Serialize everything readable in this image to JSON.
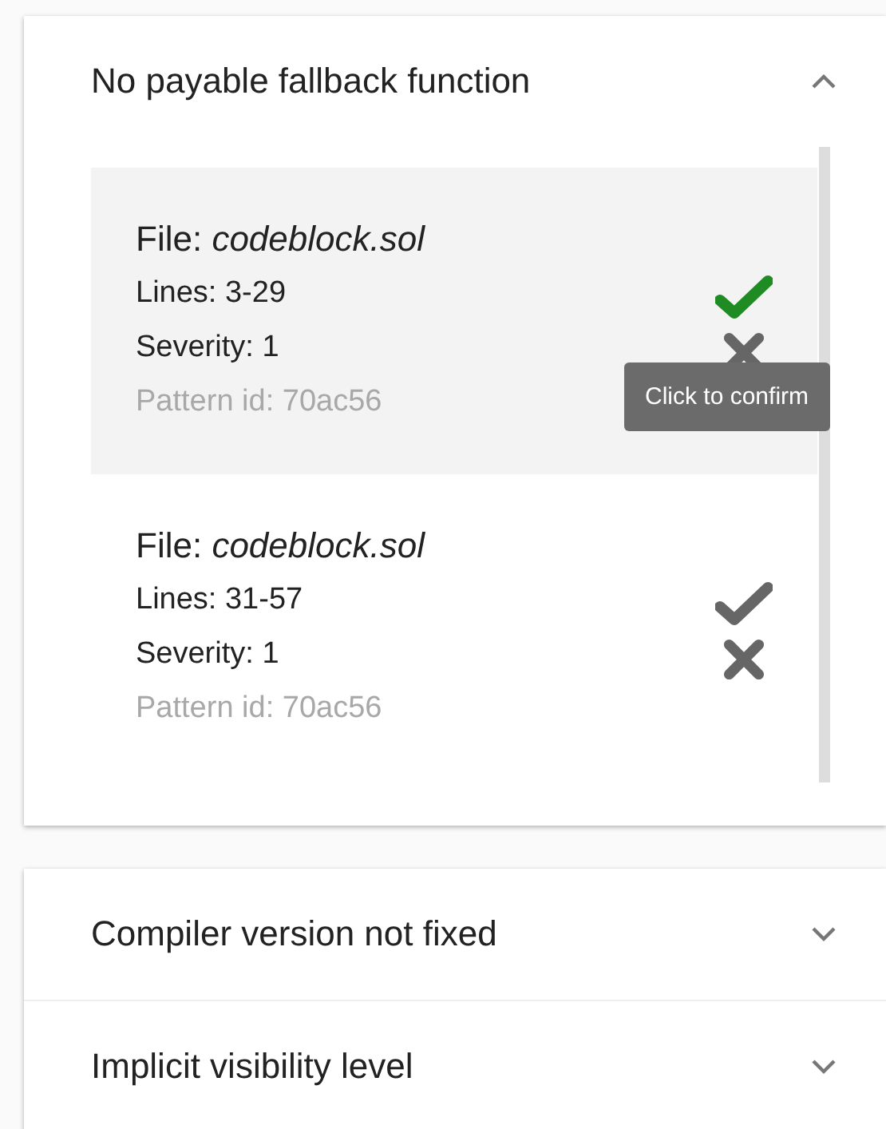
{
  "cards": [
    {
      "panels": [
        {
          "title": "No payable fallback function",
          "expanded": true,
          "findings": [
            {
              "file": "File: *codeblock.sol*",
              "lines": "Lines: 3-29",
              "severity": "Severity: 1",
              "pattern": "Pattern id: 70ac56",
              "highlighted": true,
              "confirmed": true,
              "tooltip": "Click to confirm"
            },
            {
              "file": "File: *codeblock.sol*",
              "lines": "Lines: 31-57",
              "severity": "Severity: 1",
              "pattern": "Pattern id: 70ac56",
              "highlighted": false,
              "confirmed": false
            }
          ]
        }
      ]
    },
    {
      "panels": [
        {
          "title": "Compiler version not fixed",
          "expanded": false
        },
        {
          "title": "Implicit visibility level",
          "expanded": false
        }
      ]
    }
  ]
}
